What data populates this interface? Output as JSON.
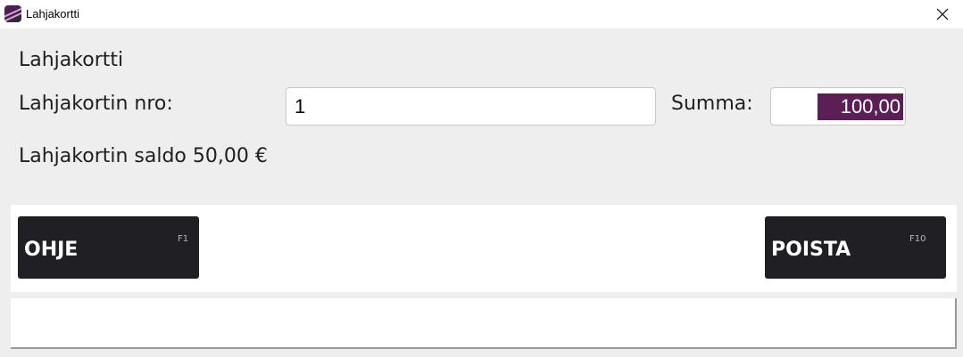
{
  "window": {
    "title": "Lahjakortti",
    "app_icon": "app-logo-icon",
    "close_icon": "close-icon"
  },
  "form": {
    "heading": "Lahjakortti",
    "card_number_label": "Lahjakortin nro:",
    "card_number_value": "1",
    "amount_label": "Summa:",
    "amount_value": "100,00",
    "balance_text": "Lahjakortin saldo 50,00 €"
  },
  "buttons": {
    "help_label": "OHJE",
    "help_key": "F1",
    "delete_label": "POISTA",
    "delete_key": "F10"
  },
  "colors": {
    "selection": "#5c1f55",
    "button_bg": "#1f1f24",
    "panel_bg": "#eeeeee"
  }
}
